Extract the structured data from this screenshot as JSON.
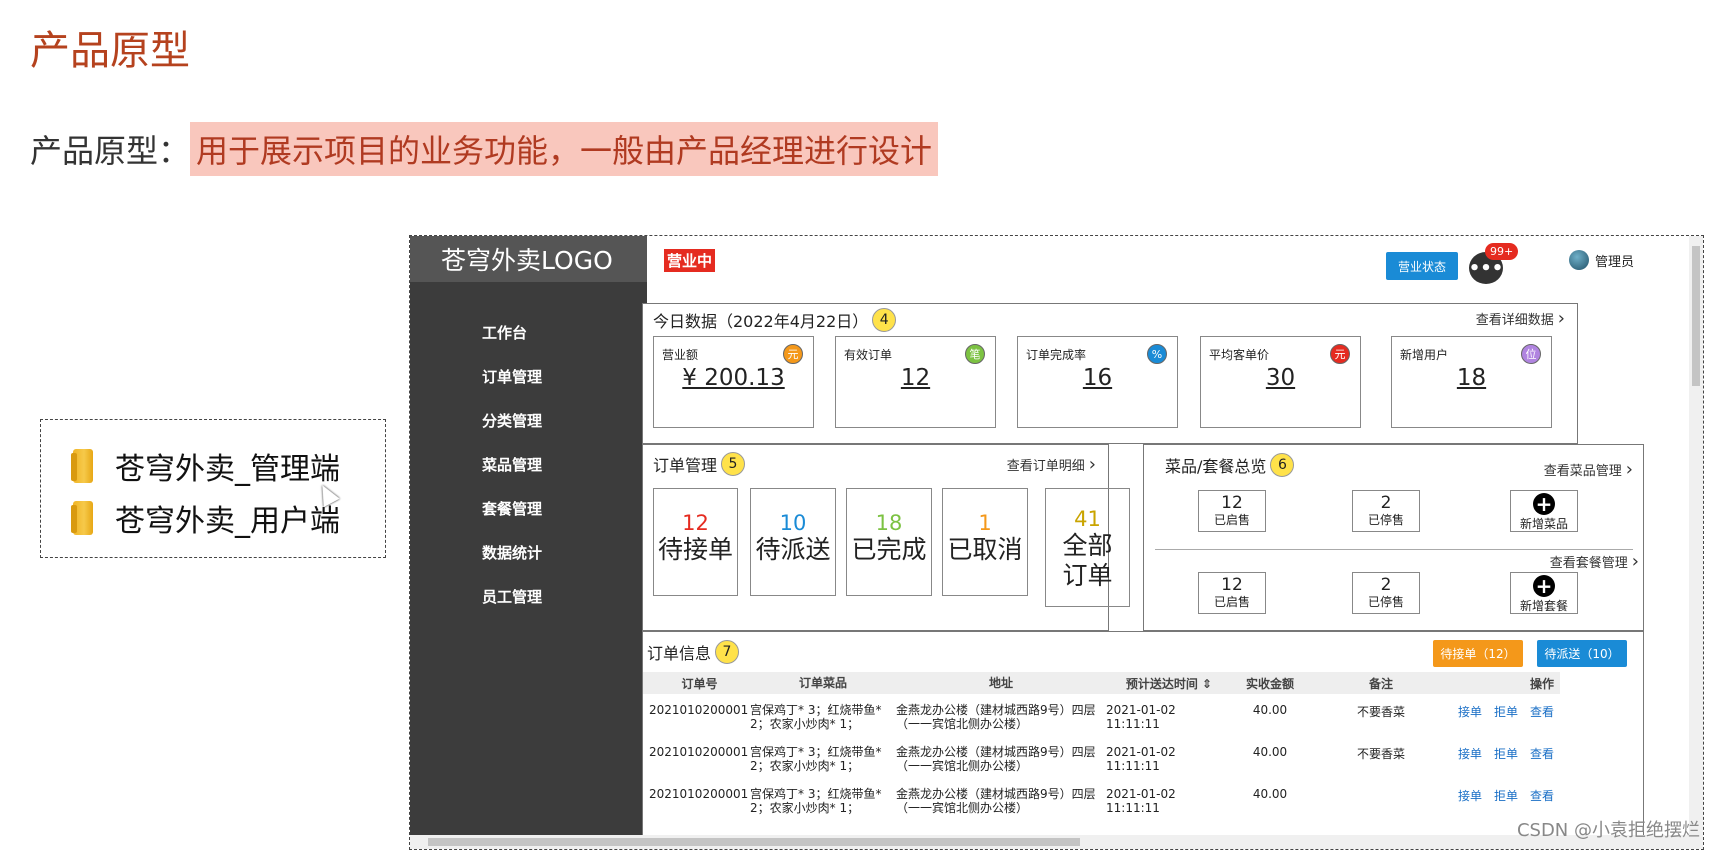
{
  "slide": {
    "title": "产品原型",
    "subtitle_prefix": "产品原型：",
    "subtitle_highlight": "用于展示项目的业务功能，一般由产品经理进行设计"
  },
  "folders": [
    {
      "label": "苍穹外卖_管理端",
      "icon": "folder-icon"
    },
    {
      "label": "苍穹外卖_用户端",
      "icon": "folder-icon"
    }
  ],
  "proto": {
    "logo": "苍穹外卖LOGO",
    "nav": [
      "工作台",
      "订单管理",
      "分类管理",
      "菜品管理",
      "套餐管理",
      "数据统计",
      "员工管理"
    ],
    "topbar": {
      "status_badge": "营业中",
      "status_button": "营业状态",
      "msg_icon": "•••",
      "msg_count": "99+",
      "admin": "管理员"
    },
    "today": {
      "title": "今日数据（2022年4月22日）",
      "num": "4",
      "more": "查看详细数据",
      "cards": [
        {
          "label": "营业额",
          "icon": "元",
          "icon_color": "#f4981a",
          "value": "¥ 200.13"
        },
        {
          "label": "有效订单",
          "icon": "笔",
          "icon_color": "#7cc242",
          "value": "12"
        },
        {
          "label": "订单完成率",
          "icon": "%",
          "icon_color": "#1a8bd6",
          "value": "16"
        },
        {
          "label": "平均客单价",
          "icon": "元",
          "icon_color": "#e52b20",
          "value": "30"
        },
        {
          "label": "新增用户",
          "icon": "位",
          "icon_color": "#b084e0",
          "value": "18"
        }
      ]
    },
    "orders": {
      "title": "订单管理",
      "num": "5",
      "more": "查看订单明细",
      "cards": [
        {
          "num": "12",
          "color": "#e52b20",
          "label": "待接单"
        },
        {
          "num": "10",
          "color": "#1a8bd6",
          "label": "待派送"
        },
        {
          "num": "18",
          "color": "#7cc242",
          "label": "已完成"
        },
        {
          "num": "1",
          "color": "#f4981a",
          "label": "已取消"
        },
        {
          "num": "41",
          "color": "#c9a400",
          "label": "全部订单"
        }
      ]
    },
    "dishes": {
      "title": "菜品/套餐总览",
      "num": "6",
      "more_dish": "查看菜品管理",
      "more_combo": "查看套餐管理",
      "dish_on_num": "12",
      "dish_on_label": "已启售",
      "dish_off_num": "2",
      "dish_off_label": "已停售",
      "dish_add": "新增菜品",
      "combo_on_num": "12",
      "combo_on_label": "已启售",
      "combo_off_num": "2",
      "combo_off_label": "已停售",
      "combo_add": "新增套餐"
    },
    "info": {
      "title": "订单信息",
      "num": "7",
      "btn_pending": "待接单（12）",
      "btn_delivery": "待派送（10）",
      "headers": [
        "订单号",
        "订单菜品",
        "地址",
        "预计送达时间 ⇕",
        "实收金额",
        "备注",
        "操作"
      ],
      "rows": [
        {
          "id": "2021010200001",
          "dishes": "宫保鸡丁* 3；红烧带鱼* 2；农家小炒肉* 1；",
          "address": "金燕龙办公楼（建材城西路9号）四层（一一宾馆北侧办公楼）",
          "time": "2021-01-02 11:11:11",
          "amount": "40.00",
          "note": "不要香菜",
          "a1": "接单",
          "a2": "拒单",
          "a3": "查看"
        },
        {
          "id": "2021010200001",
          "dishes": "宫保鸡丁* 3；红烧带鱼* 2；农家小炒肉* 1；",
          "address": "金燕龙办公楼（建材城西路9号）四层（一一宾馆北侧办公楼）",
          "time": "2021-01-02 11:11:11",
          "amount": "40.00",
          "note": "不要香菜",
          "a1": "接单",
          "a2": "拒单",
          "a3": "查看"
        },
        {
          "id": "2021010200001",
          "dishes": "宫保鸡丁* 3；红烧带鱼* 2；农家小炒肉* 1；",
          "address": "金燕龙办公楼（建材城西路9号）四层（一一宾馆北侧办公楼）",
          "time": "2021-01-02 11:11:11",
          "amount": "40.00",
          "note": "",
          "a1": "接单",
          "a2": "拒单",
          "a3": "查看"
        }
      ]
    }
  },
  "watermark": "CSDN @小袁拒绝摆烂"
}
